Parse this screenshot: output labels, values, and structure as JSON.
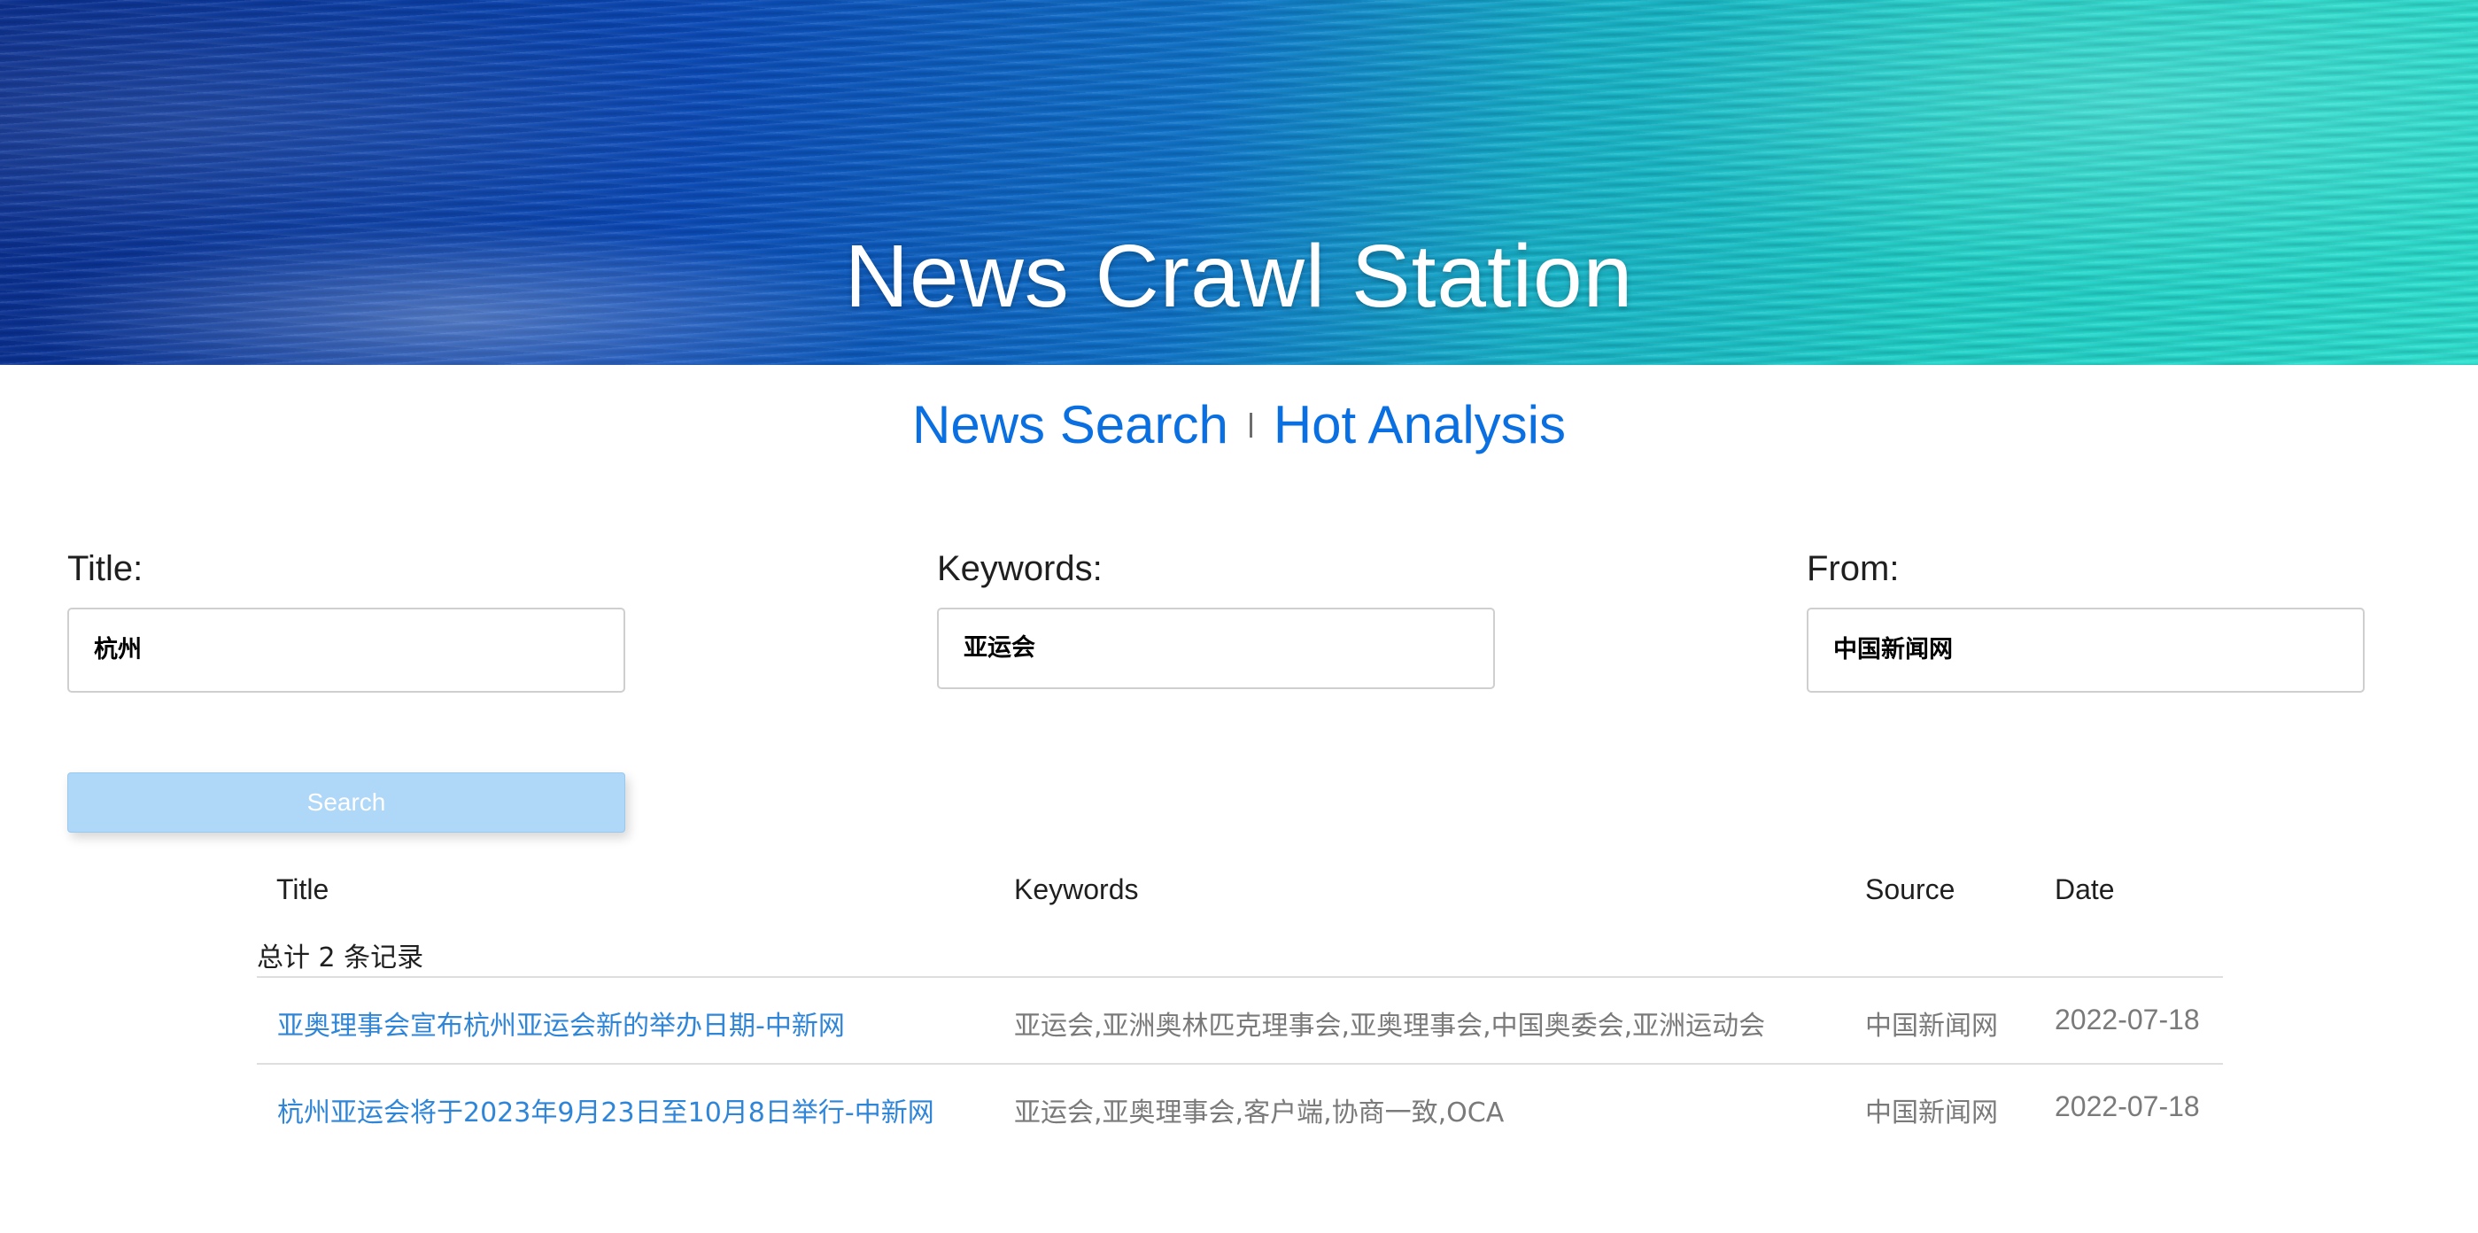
{
  "header": {
    "title": "News Crawl Station"
  },
  "nav": {
    "items": [
      {
        "label": "News Search"
      },
      {
        "label": "Hot Analysis"
      }
    ]
  },
  "form": {
    "title": {
      "label": "Title:",
      "value": "杭州"
    },
    "keywords": {
      "label": "Keywords:",
      "value": "亚运会"
    },
    "from": {
      "label": "From:",
      "value": "中国新闻网"
    },
    "search_label": "Search"
  },
  "table": {
    "headers": {
      "title": "Title",
      "keywords": "Keywords",
      "source": "Source",
      "date": "Date"
    },
    "total_text": "总计 2 条记录",
    "rows": [
      {
        "title": "亚奥理事会宣布杭州亚运会新的举办日期-中新网",
        "keywords": "亚运会,亚洲奥林匹克理事会,亚奥理事会,中国奥委会,亚洲运动会",
        "source": "中国新闻网",
        "date": "2022-07-18"
      },
      {
        "title": "杭州亚运会将于2023年9月23日至10月8日举行-中新网",
        "keywords": "亚运会,亚奥理事会,客户端,协商一致,OCA",
        "source": "中国新闻网",
        "date": "2022-07-18"
      }
    ]
  },
  "colors": {
    "link": "#0a6fe0",
    "row_link": "#2f86d8",
    "button_bg": "#afd7f7"
  }
}
